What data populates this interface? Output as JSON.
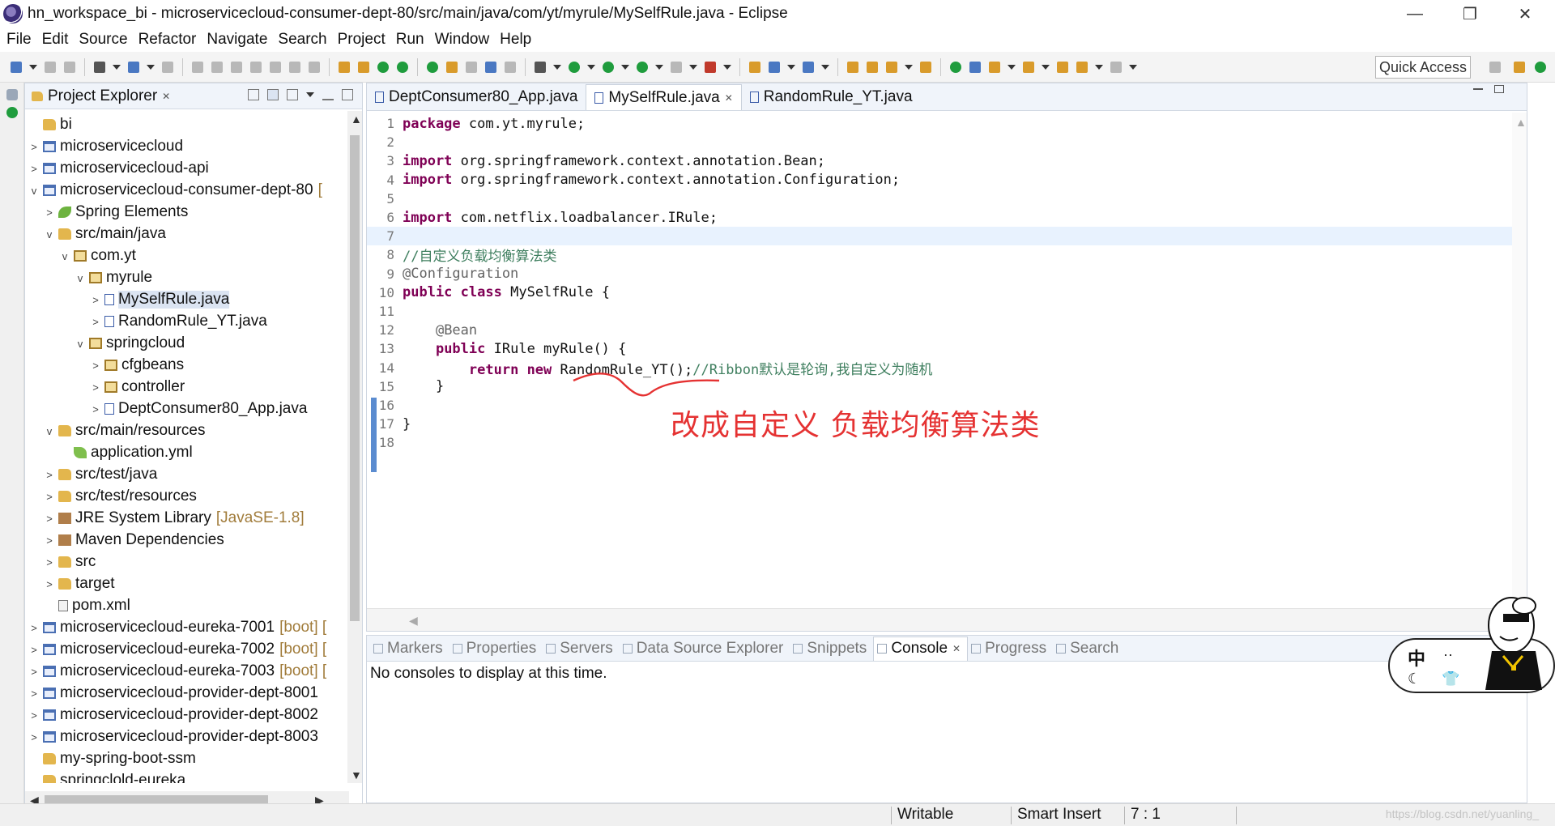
{
  "window": {
    "title": "hn_workspace_bi - microservicecloud-consumer-dept-80/src/main/java/com/yt/myrule/MySelfRule.java - Eclipse",
    "controls": {
      "minimize": "—",
      "restore": "❐",
      "close": "✕"
    }
  },
  "menu": [
    "File",
    "Edit",
    "Source",
    "Refactor",
    "Navigate",
    "Search",
    "Project",
    "Run",
    "Window",
    "Help"
  ],
  "toolbar": {
    "quick_access": "Quick Access"
  },
  "explorer": {
    "title": "Project Explorer",
    "close": "✕",
    "items": [
      {
        "label": "bi",
        "decor": "",
        "depth": 0,
        "twisty": "",
        "icon": "folder"
      },
      {
        "label": "microservicecloud",
        "decor": "",
        "depth": 0,
        "twisty": ">",
        "icon": "project"
      },
      {
        "label": "microservicecloud-api",
        "decor": "",
        "depth": 0,
        "twisty": ">",
        "icon": "project"
      },
      {
        "label": "microservicecloud-consumer-dept-80",
        "decor": "[",
        "depth": 0,
        "twisty": "v",
        "icon": "project"
      },
      {
        "label": "Spring Elements",
        "decor": "",
        "depth": 1,
        "twisty": ">",
        "icon": "spring"
      },
      {
        "label": "src/main/java",
        "decor": "",
        "depth": 1,
        "twisty": "v",
        "icon": "folder"
      },
      {
        "label": "com.yt",
        "decor": "",
        "depth": 2,
        "twisty": "v",
        "icon": "package"
      },
      {
        "label": "myrule",
        "decor": "",
        "depth": 3,
        "twisty": "v",
        "icon": "package"
      },
      {
        "label": "MySelfRule.java",
        "decor": "",
        "depth": 4,
        "twisty": ">",
        "icon": "java",
        "selected": true
      },
      {
        "label": "RandomRule_YT.java",
        "decor": "",
        "depth": 4,
        "twisty": ">",
        "icon": "java"
      },
      {
        "label": "springcloud",
        "decor": "",
        "depth": 3,
        "twisty": "v",
        "icon": "package"
      },
      {
        "label": "cfgbeans",
        "decor": "",
        "depth": 4,
        "twisty": ">",
        "icon": "package"
      },
      {
        "label": "controller",
        "decor": "",
        "depth": 4,
        "twisty": ">",
        "icon": "package"
      },
      {
        "label": "DeptConsumer80_App.java",
        "decor": "",
        "depth": 4,
        "twisty": ">",
        "icon": "java"
      },
      {
        "label": "src/main/resources",
        "decor": "",
        "depth": 1,
        "twisty": "v",
        "icon": "folder"
      },
      {
        "label": "application.yml",
        "decor": "",
        "depth": 2,
        "twisty": "",
        "icon": "yml"
      },
      {
        "label": "src/test/java",
        "decor": "",
        "depth": 1,
        "twisty": ">",
        "icon": "folder"
      },
      {
        "label": "src/test/resources",
        "decor": "",
        "depth": 1,
        "twisty": ">",
        "icon": "folder"
      },
      {
        "label": "JRE System Library",
        "decor": "[JavaSE-1.8]",
        "depth": 1,
        "twisty": ">",
        "icon": "lib"
      },
      {
        "label": "Maven Dependencies",
        "decor": "",
        "depth": 1,
        "twisty": ">",
        "icon": "lib"
      },
      {
        "label": "src",
        "decor": "",
        "depth": 1,
        "twisty": ">",
        "icon": "folder"
      },
      {
        "label": "target",
        "decor": "",
        "depth": 1,
        "twisty": ">",
        "icon": "folder"
      },
      {
        "label": "pom.xml",
        "decor": "",
        "depth": 1,
        "twisty": "",
        "icon": "xml"
      },
      {
        "label": "microservicecloud-eureka-7001",
        "decor": "[boot] [",
        "depth": 0,
        "twisty": ">",
        "icon": "project"
      },
      {
        "label": "microservicecloud-eureka-7002",
        "decor": "[boot] [",
        "depth": 0,
        "twisty": ">",
        "icon": "project"
      },
      {
        "label": "microservicecloud-eureka-7003",
        "decor": "[boot] [",
        "depth": 0,
        "twisty": ">",
        "icon": "project"
      },
      {
        "label": "microservicecloud-provider-dept-8001",
        "decor": "",
        "depth": 0,
        "twisty": ">",
        "icon": "project"
      },
      {
        "label": "microservicecloud-provider-dept-8002",
        "decor": "",
        "depth": 0,
        "twisty": ">",
        "icon": "project"
      },
      {
        "label": "microservicecloud-provider-dept-8003",
        "decor": "",
        "depth": 0,
        "twisty": ">",
        "icon": "project"
      },
      {
        "label": "my-spring-boot-ssm",
        "decor": "",
        "depth": 0,
        "twisty": "",
        "icon": "folder"
      },
      {
        "label": "springclold-eureka",
        "decor": "",
        "depth": 0,
        "twisty": "",
        "icon": "folder"
      }
    ]
  },
  "editor": {
    "tabs": [
      {
        "label": "DeptConsumer80_App.java",
        "active": false
      },
      {
        "label": "MySelfRule.java",
        "active": true
      },
      {
        "label": "RandomRule_YT.java",
        "active": false
      }
    ],
    "lines": [
      {
        "n": "1",
        "tokens": [
          [
            "kw",
            "package"
          ],
          [
            "",
            "com.yt.myrule;"
          ]
        ]
      },
      {
        "n": "2",
        "tokens": []
      },
      {
        "n": "3",
        "tokens": [
          [
            "kw",
            "import"
          ],
          [
            "",
            "org.springframework.context.annotation.Bean;"
          ]
        ]
      },
      {
        "n": "4",
        "tokens": [
          [
            "kw",
            "import"
          ],
          [
            "",
            "org.springframework.context.annotation.Configuration;"
          ]
        ]
      },
      {
        "n": "5",
        "tokens": []
      },
      {
        "n": "6",
        "tokens": [
          [
            "kw",
            "import"
          ],
          [
            "",
            "com.netflix.loadbalancer.IRule;"
          ]
        ]
      },
      {
        "n": "7",
        "tokens": [],
        "current": true
      },
      {
        "n": "8",
        "tokens": [
          [
            "cm",
            "//自定义负载均衡算法类"
          ]
        ]
      },
      {
        "n": "9",
        "tokens": [
          [
            "an",
            "@Configuration"
          ]
        ]
      },
      {
        "n": "10",
        "tokens": [
          [
            "kw",
            "public"
          ],
          [
            "kw",
            "class"
          ],
          [
            "",
            "MySelfRule {"
          ]
        ]
      },
      {
        "n": "11",
        "tokens": []
      },
      {
        "n": "12",
        "tokens": [
          [
            "",
            "    "
          ],
          [
            "an",
            "@Bean"
          ]
        ]
      },
      {
        "n": "13",
        "tokens": [
          [
            "",
            "    "
          ],
          [
            "kw",
            "public"
          ],
          [
            "",
            "IRule myRule() {"
          ]
        ]
      },
      {
        "n": "14",
        "tokens": [
          [
            "",
            "        "
          ],
          [
            "kw",
            "return"
          ],
          [
            "kw",
            "new"
          ],
          [
            "",
            "RandomRule_YT();"
          ],
          [
            "cm",
            "//Ribbon默认是轮询,我自定义为随机"
          ]
        ]
      },
      {
        "n": "15",
        "tokens": [
          [
            "",
            "    }"
          ]
        ]
      },
      {
        "n": "16",
        "tokens": []
      },
      {
        "n": "17",
        "tokens": [
          [
            "",
            "}"
          ]
        ]
      },
      {
        "n": "18",
        "tokens": []
      }
    ],
    "annotation": "改成自定义  负载均衡算法类"
  },
  "bottom": {
    "tabs": [
      {
        "label": "Markers",
        "active": false
      },
      {
        "label": "Properties",
        "active": false
      },
      {
        "label": "Servers",
        "active": false
      },
      {
        "label": "Data Source Explorer",
        "active": false
      },
      {
        "label": "Snippets",
        "active": false
      },
      {
        "label": "Console",
        "active": true
      },
      {
        "label": "Progress",
        "active": false
      },
      {
        "label": "Search",
        "active": false
      }
    ],
    "console_message": "No consoles to display at this time."
  },
  "status": {
    "writable": "Writable",
    "insert_mode": "Smart Insert",
    "position": "7 : 1",
    "watermark": "https://blog.csdn.net/yuanling_"
  },
  "ime": {
    "lang": "中",
    "moon": "☾",
    "dots": "··",
    "shirt": "👕"
  },
  "colors": {
    "keyword": "#7f0055",
    "comment": "#3f7f5f",
    "annotation_text": "#e53232",
    "selection": "#dbe4f2"
  }
}
